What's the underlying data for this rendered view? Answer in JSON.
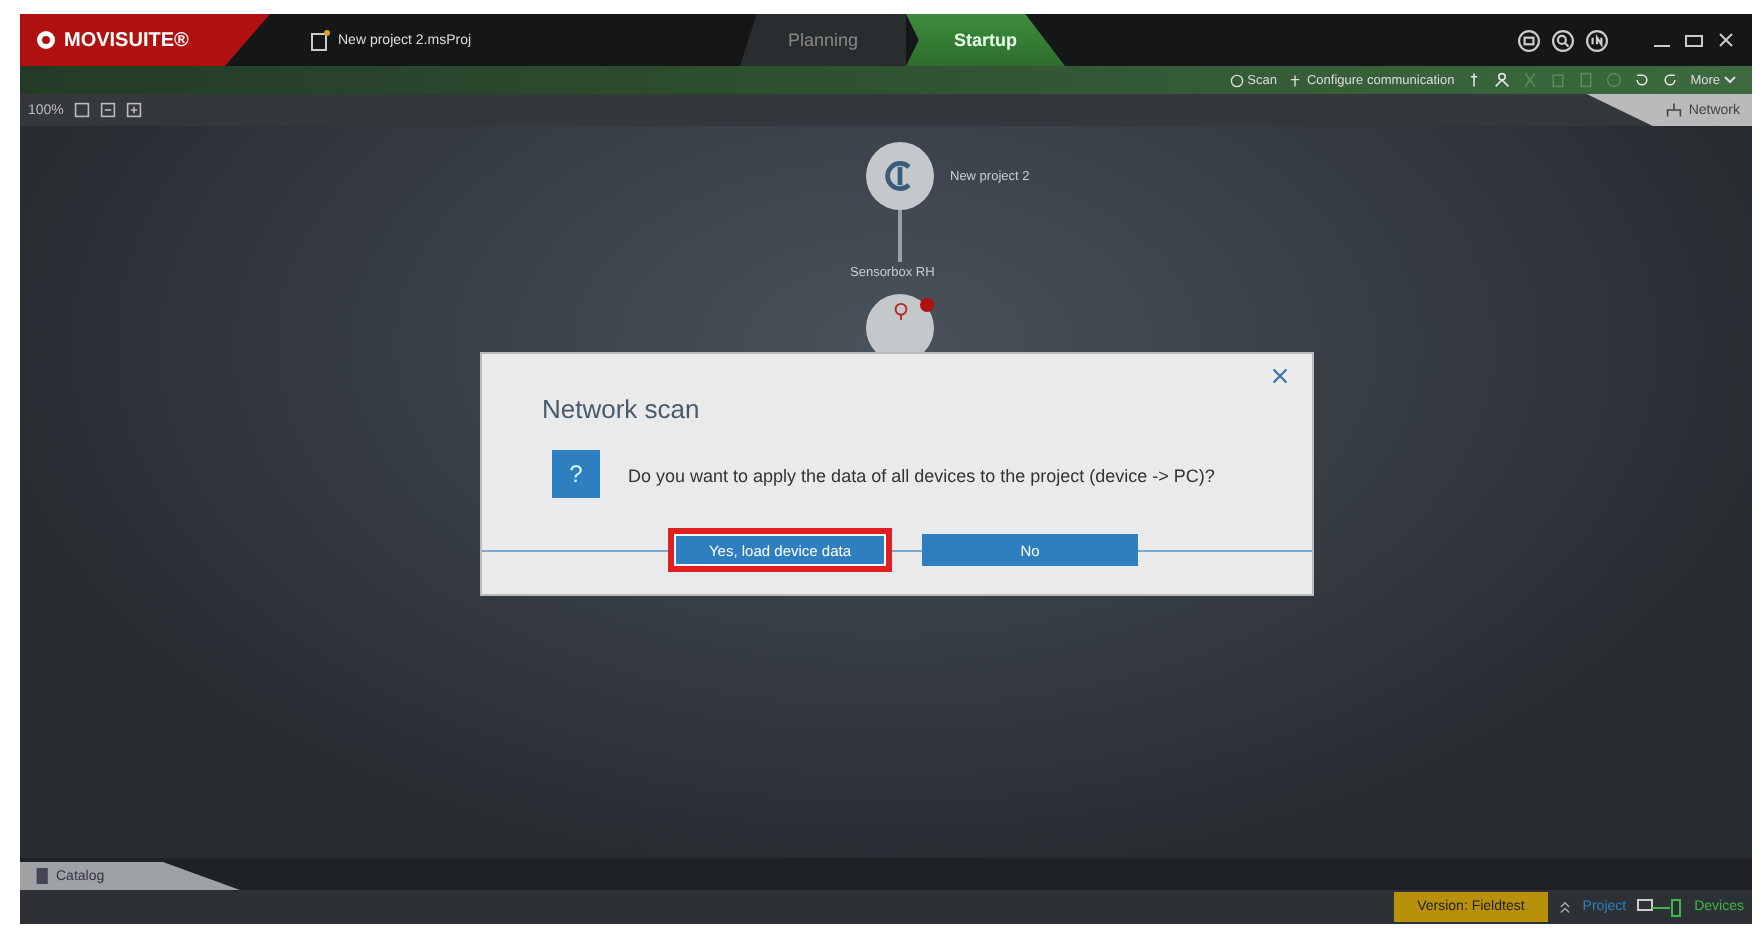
{
  "app": {
    "logo": "MOVISUITE®",
    "file_name": "New project 2.msProj"
  },
  "tabs": [
    {
      "label": "Planning",
      "selected": false
    },
    {
      "label": "Startup",
      "selected": true
    }
  ],
  "toolbar": {
    "actions": [
      "Scan",
      "Configure communication"
    ],
    "more": "More"
  },
  "zoom": "100%",
  "view_tab": "Network",
  "canvas": {
    "project": "New project 2",
    "device": "Sensorbox RH"
  },
  "dialog": {
    "title": "Network scan",
    "icon": "?",
    "message": "Do you want to apply the data of all devices to the project (device -> PC)?",
    "buttons": [
      {
        "label": "Yes, load device data",
        "highlighted": true
      },
      {
        "label": "No",
        "highlighted": false
      }
    ]
  },
  "catalog": "Catalog",
  "status": {
    "version": "Version: Fieldtest",
    "project": "Project",
    "devices": "Devices"
  }
}
